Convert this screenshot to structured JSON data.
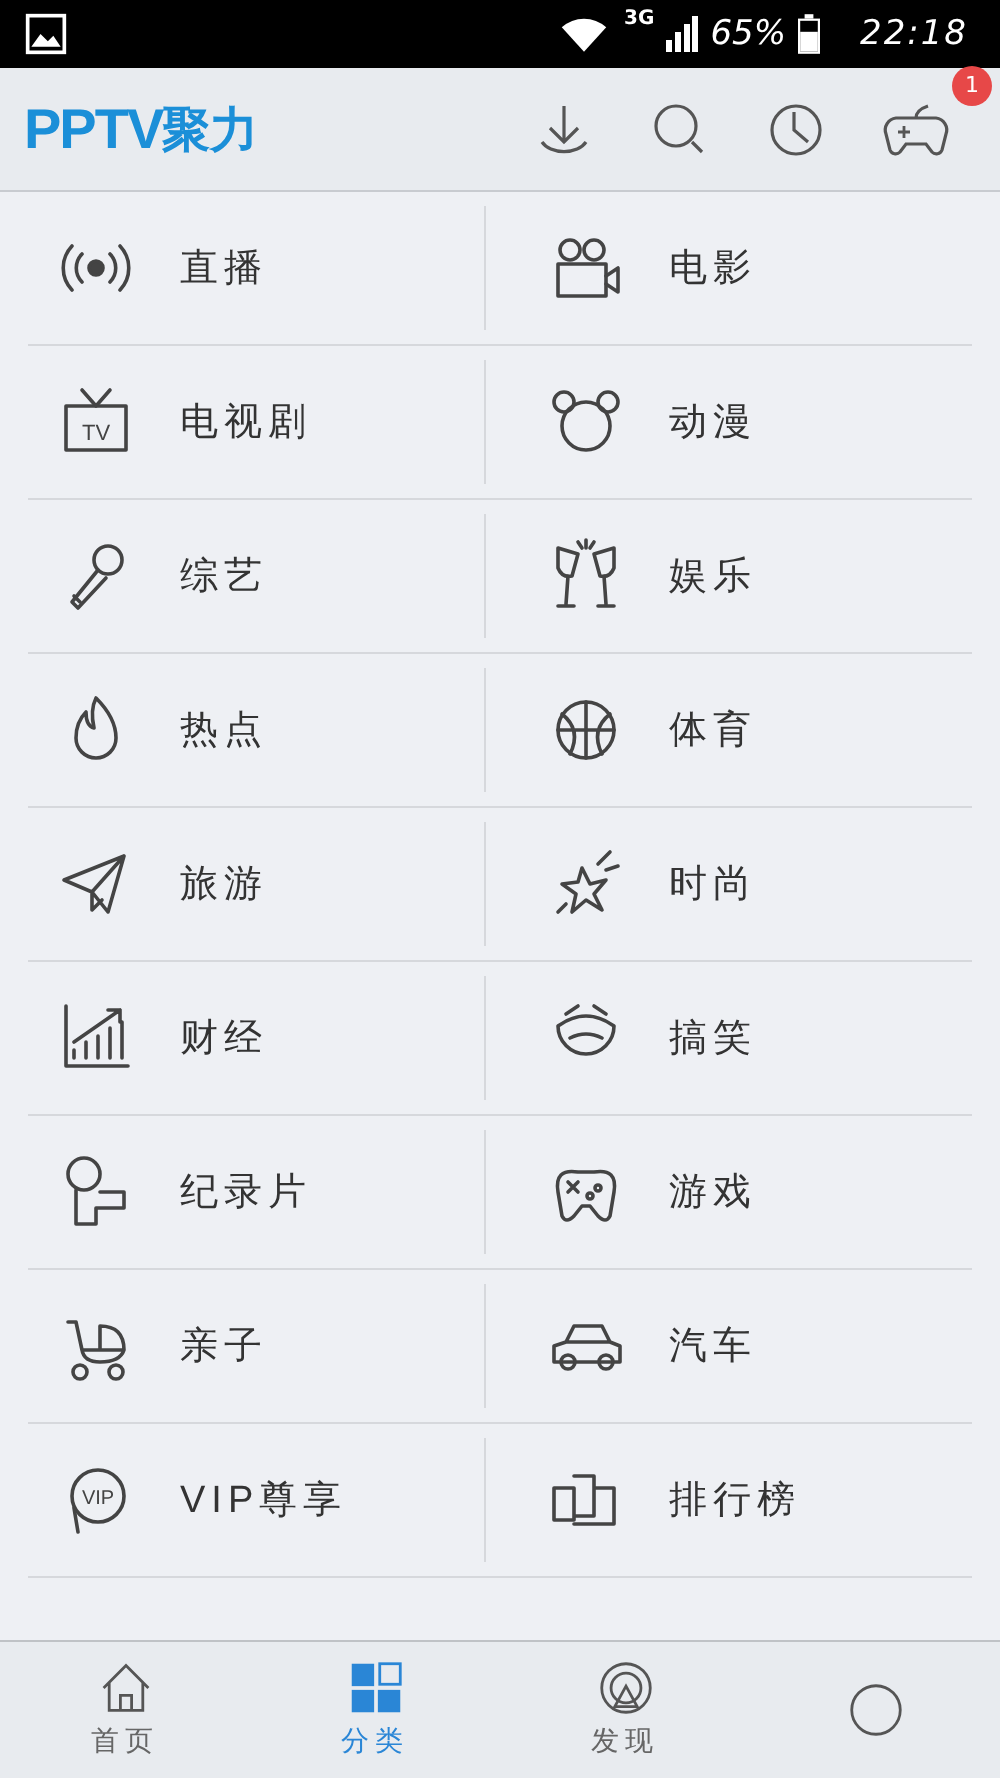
{
  "status_bar": {
    "network": "3G",
    "battery": "65%",
    "time": "22:18"
  },
  "header": {
    "logo_mark": "PPTV",
    "logo_text": "聚力",
    "badge": "1"
  },
  "categories": [
    {
      "label": "直播"
    },
    {
      "label": "电影"
    },
    {
      "label": "电视剧",
      "icon_text": "TV"
    },
    {
      "label": "动漫"
    },
    {
      "label": "综艺"
    },
    {
      "label": "娱乐"
    },
    {
      "label": "热点"
    },
    {
      "label": "体育"
    },
    {
      "label": "旅游"
    },
    {
      "label": "时尚"
    },
    {
      "label": "财经"
    },
    {
      "label": "搞笑"
    },
    {
      "label": "纪录片"
    },
    {
      "label": "游戏"
    },
    {
      "label": "亲子"
    },
    {
      "label": "汽车"
    },
    {
      "label": "VIP尊享",
      "icon_text": "VIP"
    },
    {
      "label": "排行榜"
    }
  ],
  "tabs": [
    {
      "label": "首页",
      "selected": false
    },
    {
      "label": "分类",
      "selected": true
    },
    {
      "label": "发现",
      "selected": false
    },
    {
      "selected": false
    }
  ]
}
